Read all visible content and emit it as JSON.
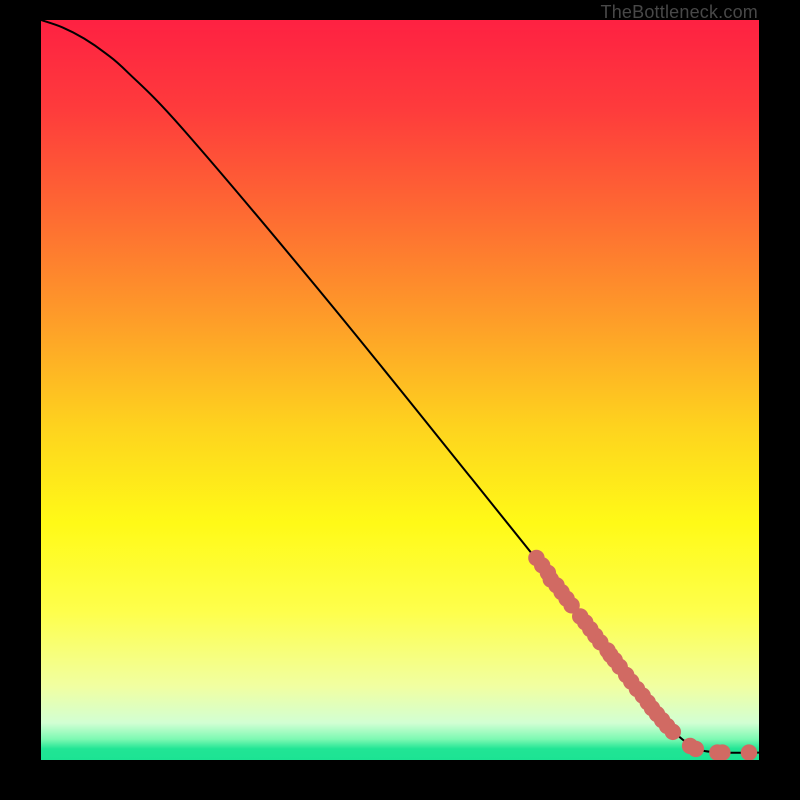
{
  "attribution": "TheBottleneck.com",
  "chart_data": {
    "type": "line",
    "title": "",
    "xlabel": "",
    "ylabel": "",
    "xlim": [
      0,
      100
    ],
    "ylim": [
      0,
      100
    ],
    "curve": {
      "x": [
        0,
        3,
        6,
        9,
        12,
        20,
        40,
        60,
        72,
        80,
        85,
        88,
        90,
        92,
        95,
        100
      ],
      "y": [
        100,
        99,
        97.5,
        95.5,
        93,
        85,
        62,
        38,
        23.5,
        14,
        7.5,
        4,
        2.3,
        1.3,
        1,
        1
      ]
    },
    "markers": {
      "x": [
        69.0,
        69.8,
        70.6,
        71.0,
        71.8,
        72.5,
        73.2,
        73.9,
        75.1,
        75.8,
        76.5,
        77.2,
        77.9,
        78.9,
        79.3,
        79.9,
        80.6,
        81.5,
        82.2,
        83.0,
        83.8,
        84.5,
        85.1,
        85.8,
        86.5,
        87.2,
        88.0,
        90.4,
        91.2,
        94.2,
        94.9,
        98.6
      ],
      "y": [
        27.3,
        26.3,
        25.3,
        24.4,
        23.6,
        22.7,
        21.8,
        20.9,
        19.4,
        18.6,
        17.7,
        16.8,
        15.9,
        14.8,
        14.2,
        13.5,
        12.6,
        11.5,
        10.6,
        9.6,
        8.7,
        7.8,
        7.0,
        6.2,
        5.4,
        4.6,
        3.8,
        1.9,
        1.5,
        1.0,
        1.0,
        1.0
      ]
    },
    "marker_color": "#d16a63",
    "curve_color": "#000000",
    "gradient_stops": [
      {
        "offset": 0.0,
        "color": "#fe2142"
      },
      {
        "offset": 0.12,
        "color": "#fe3b3c"
      },
      {
        "offset": 0.25,
        "color": "#fe6633"
      },
      {
        "offset": 0.4,
        "color": "#fe9b29"
      },
      {
        "offset": 0.55,
        "color": "#fed31e"
      },
      {
        "offset": 0.68,
        "color": "#fffa17"
      },
      {
        "offset": 0.8,
        "color": "#feff4c"
      },
      {
        "offset": 0.9,
        "color": "#f1ffa1"
      },
      {
        "offset": 0.95,
        "color": "#d2ffd3"
      },
      {
        "offset": 0.972,
        "color": "#7cf9b2"
      },
      {
        "offset": 0.985,
        "color": "#21e595"
      },
      {
        "offset": 1.0,
        "color": "#1ce393"
      }
    ]
  }
}
